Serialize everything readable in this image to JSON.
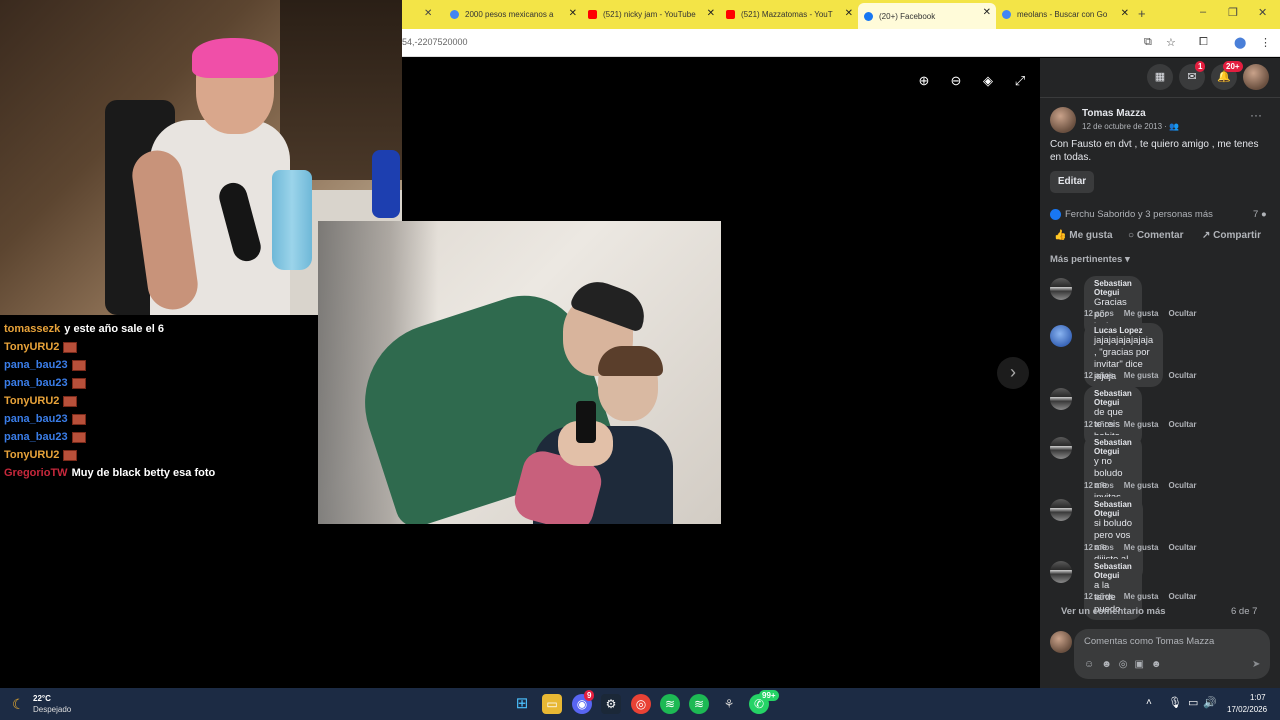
{
  "browser": {
    "tabs": [
      {
        "label": "2000 pesos mexicanos a",
        "favicon_color": "#4285f4"
      },
      {
        "label": "(521) nicky jam - YouTube",
        "favicon_color": "#ff0000"
      },
      {
        "label": "(521) Mazzatomas - YouT",
        "favicon_color": "#ff0000"
      },
      {
        "label": "(20+) Facebook",
        "favicon_color": "#1877f2"
      },
      {
        "label": "meolans - Buscar con Go",
        "favicon_color": "#4285f4"
      }
    ],
    "url": "54,-2207520000"
  },
  "chat": {
    "lines": [
      {
        "user": "tomassezk",
        "color": "#e8a33a",
        "msg": "y este año sale el 6",
        "badge": false
      },
      {
        "user": "TonyURU2",
        "color": "#e8a33a",
        "msg": "",
        "badge": true
      },
      {
        "user": "pana_bau23",
        "color": "#3a7de8",
        "msg": "",
        "badge": true
      },
      {
        "user": "pana_bau23",
        "color": "#3a7de8",
        "msg": "",
        "badge": true
      },
      {
        "user": "TonyURU2",
        "color": "#e8a33a",
        "msg": "",
        "badge": true
      },
      {
        "user": "pana_bau23",
        "color": "#3a7de8",
        "msg": "",
        "badge": true
      },
      {
        "user": "pana_bau23",
        "color": "#3a7de8",
        "msg": "",
        "badge": true
      },
      {
        "user": "TonyURU2",
        "color": "#e8a33a",
        "msg": "",
        "badge": true
      },
      {
        "user": "GregorioTW",
        "color": "#c8283c",
        "msg": "Muy de black betty esa foto",
        "badge": false
      }
    ]
  },
  "facebook": {
    "top_badges": {
      "messenger": "1",
      "notifications": "20+"
    },
    "post": {
      "author": "Tomas Mazza",
      "date": "12 de octubre de 2013 ·",
      "text": "Con Fausto en dvt , te quiero amigo , me tenes en todas.",
      "edit_label": "Editar",
      "reactions": "Ferchu Saborido y 3 personas más",
      "comment_count": "7",
      "actions": {
        "like": "Me gusta",
        "comment": "Comentar",
        "share": "Compartir"
      },
      "sort_label": "Más pertinentes"
    },
    "comments": [
      {
        "name": "Sebastian Otegui",
        "text": "Gracias por invitar",
        "age": "12 años",
        "like": "Me gusta",
        "hide": "Ocultar"
      },
      {
        "name": "Lucas Lopez",
        "text": "jajajajajajajaja , \"gracias por invitar\" dice jajaja",
        "age": "12 años",
        "like": "Me gusta",
        "hide": "Ocultar"
      },
      {
        "name": "Sebastian Otegui",
        "text": "de que te reis bobito",
        "age": "12 años",
        "like": "Me gusta",
        "hide": "Ocultar"
      },
      {
        "name": "Sebastian Otegui",
        "text": "y no boludo me invitas cuando no puedo forro",
        "age": "12 años",
        "like": "Me gusta",
        "hide": "Ocultar"
      },
      {
        "name": "Sebastian Otegui",
        "text": "si boludo pero vos me dijiste al mediodia",
        "age": "12 años",
        "like": "Me gusta",
        "hide": "Ocultar"
      },
      {
        "name": "Sebastian Otegui",
        "text": "a la tarde puedo",
        "age": "12 años",
        "like": "Me gusta",
        "hide": "Ocultar"
      }
    ],
    "more_comments": "Ver un comentario más",
    "pager": "6 de 7",
    "input_placeholder": "Comentas como Tomas Mazza"
  },
  "taskbar": {
    "weather_temp": "22°C",
    "weather_desc": "Despejado",
    "time": "1:07",
    "date": "17/02/2026",
    "discord_badge": "9",
    "whatsapp_badge": "99+"
  }
}
